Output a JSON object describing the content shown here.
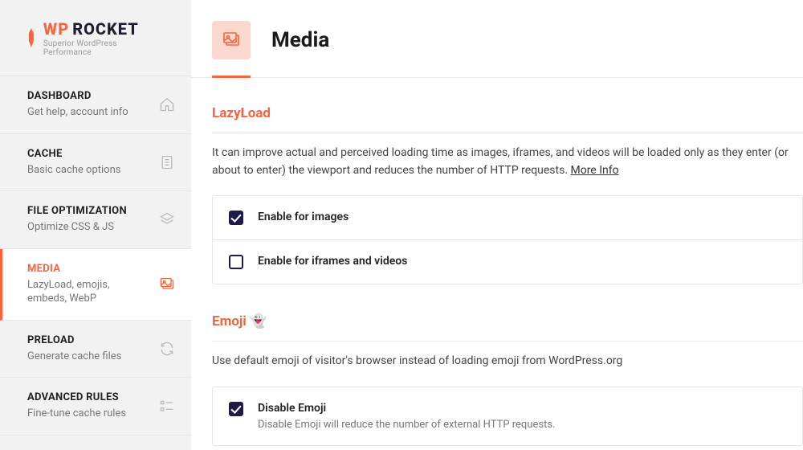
{
  "logo": {
    "wp": "WP",
    "rocket": "ROCKET",
    "tagline": "Superior WordPress Performance"
  },
  "nav": [
    {
      "title": "DASHBOARD",
      "sub": "Get help, account info"
    },
    {
      "title": "CACHE",
      "sub": "Basic cache options"
    },
    {
      "title": "FILE OPTIMIZATION",
      "sub": "Optimize CSS & JS"
    },
    {
      "title": "MEDIA",
      "sub": "LazyLoad, emojis, embeds, WebP"
    },
    {
      "title": "PRELOAD",
      "sub": "Generate cache files"
    },
    {
      "title": "ADVANCED RULES",
      "sub": "Fine-tune cache rules"
    }
  ],
  "page": {
    "title": "Media"
  },
  "lazyload": {
    "heading": "LazyLoad",
    "desc": "It can improve actual and perceived loading time as images, iframes, and videos will be loaded only as they enter (or about to enter) the viewport and reduces the number of HTTP requests. ",
    "more": "More Info",
    "opt1": "Enable for images",
    "opt2": "Enable for iframes and videos"
  },
  "emoji": {
    "heading": "Emoji 👻",
    "desc": "Use default emoji of visitor's browser instead of loading emoji from WordPress.org",
    "opt1": "Disable Emoji",
    "opt1sub": "Disable Emoji will reduce the number of external HTTP requests."
  }
}
